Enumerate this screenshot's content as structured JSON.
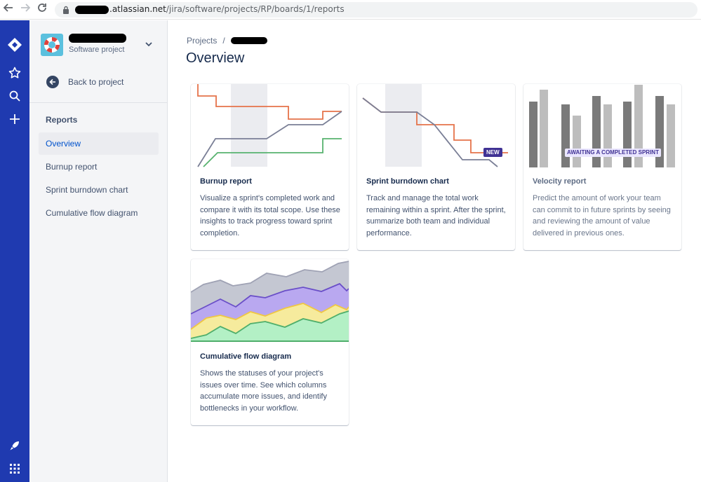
{
  "browser": {
    "url_domain": ".atlassian.net",
    "url_path": "/jira/software/projects/RP/boards/1/reports"
  },
  "sidebar": {
    "project_type": "Software project",
    "back_label": "Back to project",
    "heading": "Reports",
    "items": [
      {
        "label": "Overview",
        "active": true
      },
      {
        "label": "Burnup report"
      },
      {
        "label": "Sprint burndown chart"
      },
      {
        "label": "Cumulative flow diagram"
      }
    ]
  },
  "breadcrumb": {
    "root": "Projects",
    "separator": "/"
  },
  "page": {
    "title": "Overview"
  },
  "cards": [
    {
      "title": "Burnup report",
      "description": "Visualize a sprint's completed work and compare it with its total scope. Use these insights to track progress toward sprint completion."
    },
    {
      "title": "Sprint burndown chart",
      "description": "Track and manage the total work remaining within a sprint. After the sprint, summarize both team and individual performance.",
      "badge": "NEW"
    },
    {
      "title": "Velocity report",
      "description": "Predict the amount of work your team can commit to in future sprints by seeing and reviewing the amount of value delivered in previous ones.",
      "badge": "AWAITING A COMPLETED SPRINT"
    },
    {
      "title": "Cumulative flow diagram",
      "description": "Shows the statuses of your project's issues over time. See which columns accumulate more issues, and identify bottlenecks in your workflow."
    }
  ],
  "colors": {
    "rail": "#1f3ab0",
    "orange": "#e5734a",
    "grey_line": "#7a7f96",
    "green": "#57b26f",
    "purple": "#403294"
  },
  "icons": {
    "rail": [
      "jira-logo-icon",
      "star-icon",
      "search-icon",
      "plus-icon",
      "rocket-icon",
      "app-switcher-icon"
    ]
  }
}
